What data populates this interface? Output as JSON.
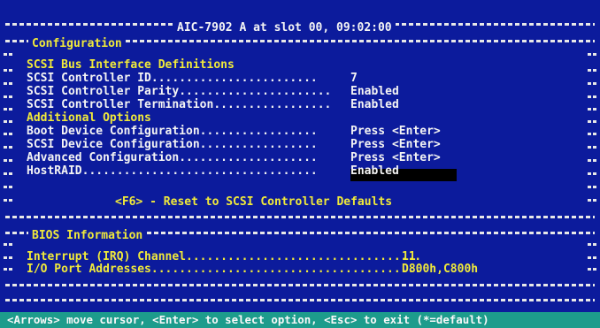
{
  "header": {
    "title": "AIC-7902 A at slot 00, 09:02:00",
    "section_label": "Configuration"
  },
  "config": {
    "group1_heading": "SCSI Bus Interface Definitions",
    "rows1": [
      {
        "label": "SCSI Controller ID",
        "dots": "........................",
        "value": "7"
      },
      {
        "label": "SCSI Controller Parity",
        "dots": "......................",
        "value": "Enabled"
      },
      {
        "label": "SCSI Controller Termination",
        "dots": ".................",
        "value": "Enabled"
      }
    ],
    "group2_heading": "Additional Options",
    "rows2": [
      {
        "label": "Boot Device Configuration",
        "dots": ".................",
        "value": "Press <Enter>"
      },
      {
        "label": "SCSI Device Configuration",
        "dots": ".................",
        "value": "Press <Enter>"
      },
      {
        "label": "Advanced Configuration",
        "dots": "....................",
        "value": "Press <Enter>"
      },
      {
        "label": "HostRAID",
        "dots": "..................................",
        "value": "Enabled"
      }
    ],
    "reset_label": "<F6> - Reset to SCSI Controller Defaults"
  },
  "bios": {
    "section_label": "BIOS Information",
    "rows": [
      {
        "label": "Interrupt (IRQ) Channel",
        "dots": "..................................",
        "value": "11"
      },
      {
        "label": "I/O Port Addresses",
        "dots": ".......................................",
        "value": "D800h,C800h"
      }
    ]
  },
  "status_bar": {
    "text": "<Arrows> move cursor, <Enter> to select option, <Esc> to exit (*=default)"
  },
  "colors": {
    "background": "#0c1b9c",
    "heading": "#f1ea3a",
    "text": "#f4f4f4",
    "status_bar": "#1d9c8c",
    "highlight": "#000000"
  }
}
